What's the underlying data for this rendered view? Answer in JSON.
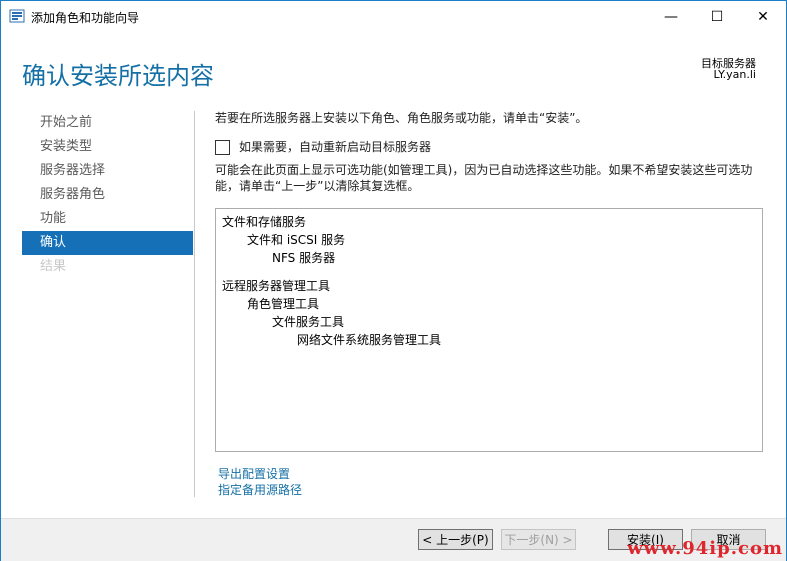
{
  "window": {
    "title": "添加角色和功能向导",
    "minimize_glyph": "—",
    "maximize_glyph": "☐",
    "close_glyph": "✕"
  },
  "header": {
    "page_title": "确认安装所选内容",
    "destination_label": "目标服务器",
    "destination_value": "LY.yan.li"
  },
  "nav": {
    "items": [
      {
        "label": "开始之前",
        "state": "normal"
      },
      {
        "label": "安装类型",
        "state": "normal"
      },
      {
        "label": "服务器选择",
        "state": "normal"
      },
      {
        "label": "服务器角色",
        "state": "normal"
      },
      {
        "label": "功能",
        "state": "normal"
      },
      {
        "label": "确认",
        "state": "active"
      },
      {
        "label": "结果",
        "state": "disabled"
      }
    ]
  },
  "content": {
    "intro": "若要在所选服务器上安装以下角色、角色服务或功能，请单击“安装”。",
    "restart_checkbox_label": "如果需要，自动重新启动目标服务器",
    "restart_checked": false,
    "note": "可能会在此页面上显示可选功能(如管理工具)，因为已自动选择这些功能。如果不希望安装这些可选功能，请单击“上一步”以清除其复选框。",
    "selections": [
      {
        "label": "文件和存储服务",
        "level": 0
      },
      {
        "label": "文件和 iSCSI 服务",
        "level": 1
      },
      {
        "label": "NFS 服务器",
        "level": 2
      },
      {
        "label": "远程服务器管理工具",
        "level": 0
      },
      {
        "label": "角色管理工具",
        "level": 1
      },
      {
        "label": "文件服务工具",
        "level": 2
      },
      {
        "label": "网络文件系统服务管理工具",
        "level": 3
      }
    ]
  },
  "links": {
    "export": "导出配置设置",
    "alternate_source": "指定备用源路径"
  },
  "footer": {
    "prev": "< 上一步(P)",
    "next": "下一步(N) >",
    "install": "安装(I)",
    "cancel": "取消"
  },
  "watermark": "www.94ip.com",
  "colors": {
    "accent": "#1570b8",
    "title": "#1570a6",
    "watermark": "#e0262c"
  }
}
